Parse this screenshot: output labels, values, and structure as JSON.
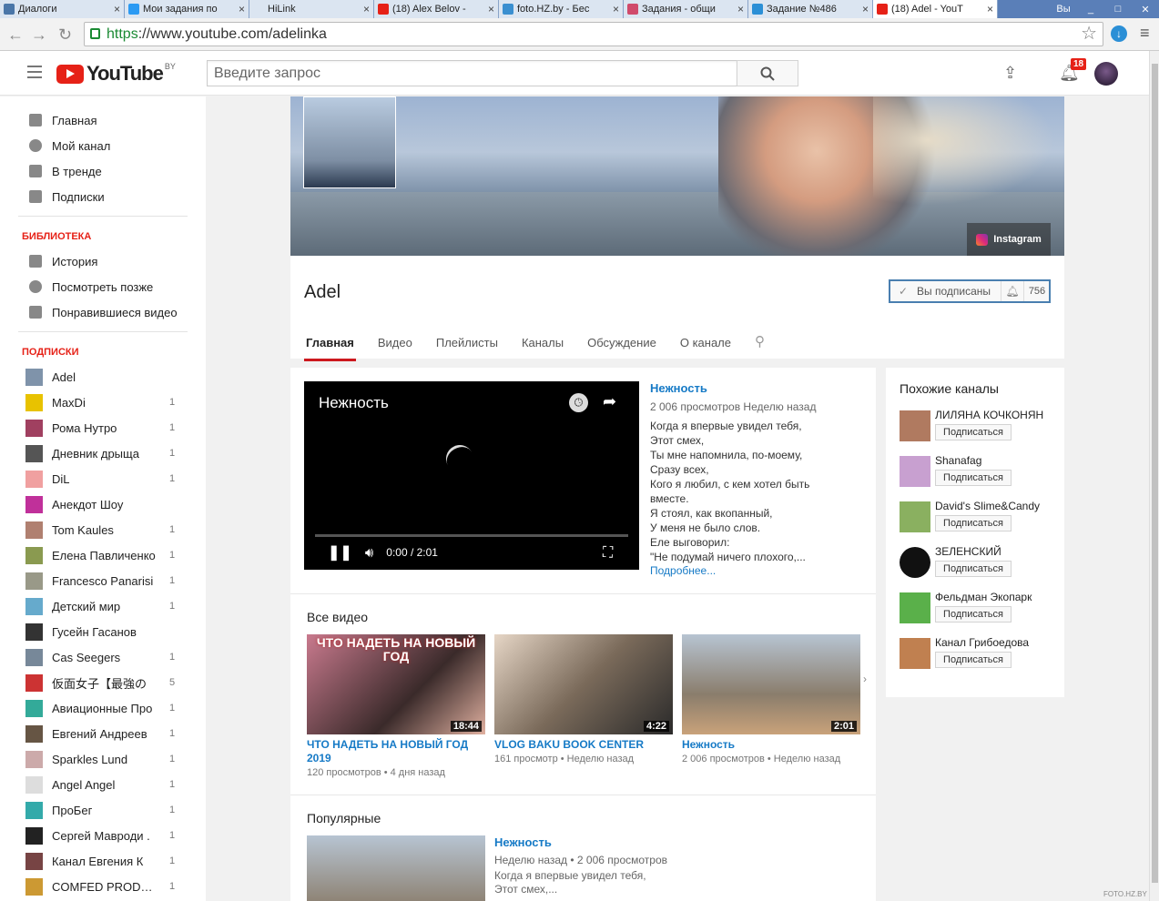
{
  "browser": {
    "tabs": [
      {
        "title": "Диалоги",
        "color": "#4a76a8"
      },
      {
        "title": "Мои задания по",
        "color": "#2b9af3"
      },
      {
        "title": "HiLink",
        "color": "#dbe5f1"
      },
      {
        "title": "(18) Alex Belov -",
        "color": "#e62117"
      },
      {
        "title": "foto.HZ.by - Бес",
        "color": "#3a8fd0"
      },
      {
        "title": "Задания - общи",
        "color": "#d04a6b"
      },
      {
        "title": "Задание №486",
        "color": "#2b8fd6"
      },
      {
        "title": "(18) Adel - YouT",
        "color": "#e62117"
      }
    ],
    "user_label": "Вы",
    "url_scheme": "https",
    "url_rest": "://www.youtube.com/adelinka"
  },
  "header": {
    "logo_text": "YouTube",
    "country": "BY",
    "search_placeholder": "Введите запрос",
    "notifications": "18"
  },
  "sidebar": {
    "main": [
      {
        "label": "Главная",
        "icon": "home-icon"
      },
      {
        "label": "Мой канал",
        "icon": "account-icon"
      },
      {
        "label": "В тренде",
        "icon": "flame-icon"
      },
      {
        "label": "Подписки",
        "icon": "subscriptions-icon"
      }
    ],
    "library_title": "БИБЛИОТЕКА",
    "library": [
      {
        "label": "История",
        "icon": "hourglass-icon"
      },
      {
        "label": "Посмотреть позже",
        "icon": "clock-icon"
      },
      {
        "label": "Понравившиеся видео",
        "icon": "thumbs-up-icon"
      }
    ],
    "subs_title": "ПОДПИСКИ",
    "subs": [
      {
        "name": "Adel",
        "count": "",
        "color": "#7f93aa"
      },
      {
        "name": "MaxDi",
        "count": "1",
        "color": "#e8c200"
      },
      {
        "name": "Рома Нутро",
        "count": "1",
        "color": "#a04060"
      },
      {
        "name": "Дневник дрыща",
        "count": "1",
        "color": "#555"
      },
      {
        "name": "DiL",
        "count": "1",
        "color": "#f0a0a0"
      },
      {
        "name": "Анекдот Шоу",
        "count": "",
        "color": "#c0309a"
      },
      {
        "name": "Tom Kaules",
        "count": "1",
        "color": "#b08070"
      },
      {
        "name": "Елена Павличенко",
        "count": "1",
        "color": "#8a9a50"
      },
      {
        "name": "Francesco Panarisi",
        "count": "1",
        "color": "#998"
      },
      {
        "name": "Детский мир",
        "count": "1",
        "color": "#6ac"
      },
      {
        "name": "Гусейн Гасанов",
        "count": "",
        "color": "#333"
      },
      {
        "name": "Cas Seegers",
        "count": "1",
        "color": "#789"
      },
      {
        "name": "仮面女子【最強の",
        "count": "5",
        "color": "#c33"
      },
      {
        "name": "Авиационные Про",
        "count": "1",
        "color": "#3a9"
      },
      {
        "name": "Евгений Андреев",
        "count": "1",
        "color": "#654"
      },
      {
        "name": "Sparkles Lund",
        "count": "1",
        "color": "#caa"
      },
      {
        "name": "Angel Angel",
        "count": "1",
        "color": "#ddd"
      },
      {
        "name": "ПроБег",
        "count": "1",
        "color": "#3aa"
      },
      {
        "name": "Сергей Мавроди .",
        "count": "1",
        "color": "#222"
      },
      {
        "name": "Канал Евгения К",
        "count": "1",
        "color": "#744"
      },
      {
        "name": "COMFED PRODUCTI",
        "count": "1",
        "color": "#c93"
      }
    ]
  },
  "channel": {
    "name": "Adel",
    "instagram": "Instagram",
    "subscribed_label": "Вы подписаны",
    "subscribers": "756",
    "tabs": [
      "Главная",
      "Видео",
      "Плейлисты",
      "Каналы",
      "Обсуждение",
      "О канале"
    ]
  },
  "featured": {
    "player_title": "Нежность",
    "time": "0:00 / 2:01",
    "title": "Нежность",
    "meta": "2 006 просмотров  Неделю назад",
    "description": [
      "Когда я впервые увидел тебя,",
      "Этот смех,",
      "Ты мне напомнила, по-моему,",
      "Сразу всех,",
      "Кого я любил, с кем хотел быть",
      "вместе.",
      "Я стоял, как вкопанный,",
      "У меня не было слов.",
      "Еле выговорил:",
      "\"Не подумай ничего плохого,..."
    ],
    "more": "Подробнее..."
  },
  "all_videos": {
    "title": "Все видео",
    "items": [
      {
        "title": "ЧТО НАДЕТЬ НА НОВЫЙ ГОД 2019",
        "meta": "120 просмотров  •  4 дня назад",
        "duration": "18:44",
        "overlay": "ЧТО НАДЕТЬ НА НОВЫЙ ГОД",
        "bg": "linear-gradient(135deg,#c97a8e,#3a2a2a 60%,#e0b0a0)"
      },
      {
        "title": "VLOG BAKU BOOK CENTER",
        "meta": "161 просмотр  •  Неделю назад",
        "duration": "4:22",
        "overlay": "",
        "bg": "linear-gradient(135deg,#e6d6c6,#7a6a5a 50%,#2a2a2a)"
      },
      {
        "title": "Нежность",
        "meta": "2 006 просмотров  •  Неделю назад",
        "duration": "2:01",
        "overlay": "",
        "bg": "linear-gradient(180deg,#b7c4d2,#8a7d6c 60%,#c9a27a)"
      }
    ]
  },
  "popular": {
    "title": "Популярные",
    "video_title": "Нежность",
    "meta": "Неделю назад  •  2 006 просмотров",
    "desc1": "Когда я впервые увидел тебя,",
    "desc2": "Этот смех,..."
  },
  "related": {
    "title": "Похожие каналы",
    "button": "Подписаться",
    "items": [
      {
        "name": "ЛИЛЯНА КОЧКОНЯН",
        "color": "#b07a60"
      },
      {
        "name": "Shanafag",
        "color": "#c8a0d0"
      },
      {
        "name": "David's Slime&Candy",
        "color": "#8ab060"
      },
      {
        "name": "ЗЕЛЕНСКИЙ",
        "color": "#111"
      },
      {
        "name": "Фельдман Экопарк",
        "color": "#5ab04a"
      },
      {
        "name": "Канал Грибоедова",
        "color": "#c08050"
      }
    ]
  },
  "watermark": "FOTO.HZ.BY"
}
